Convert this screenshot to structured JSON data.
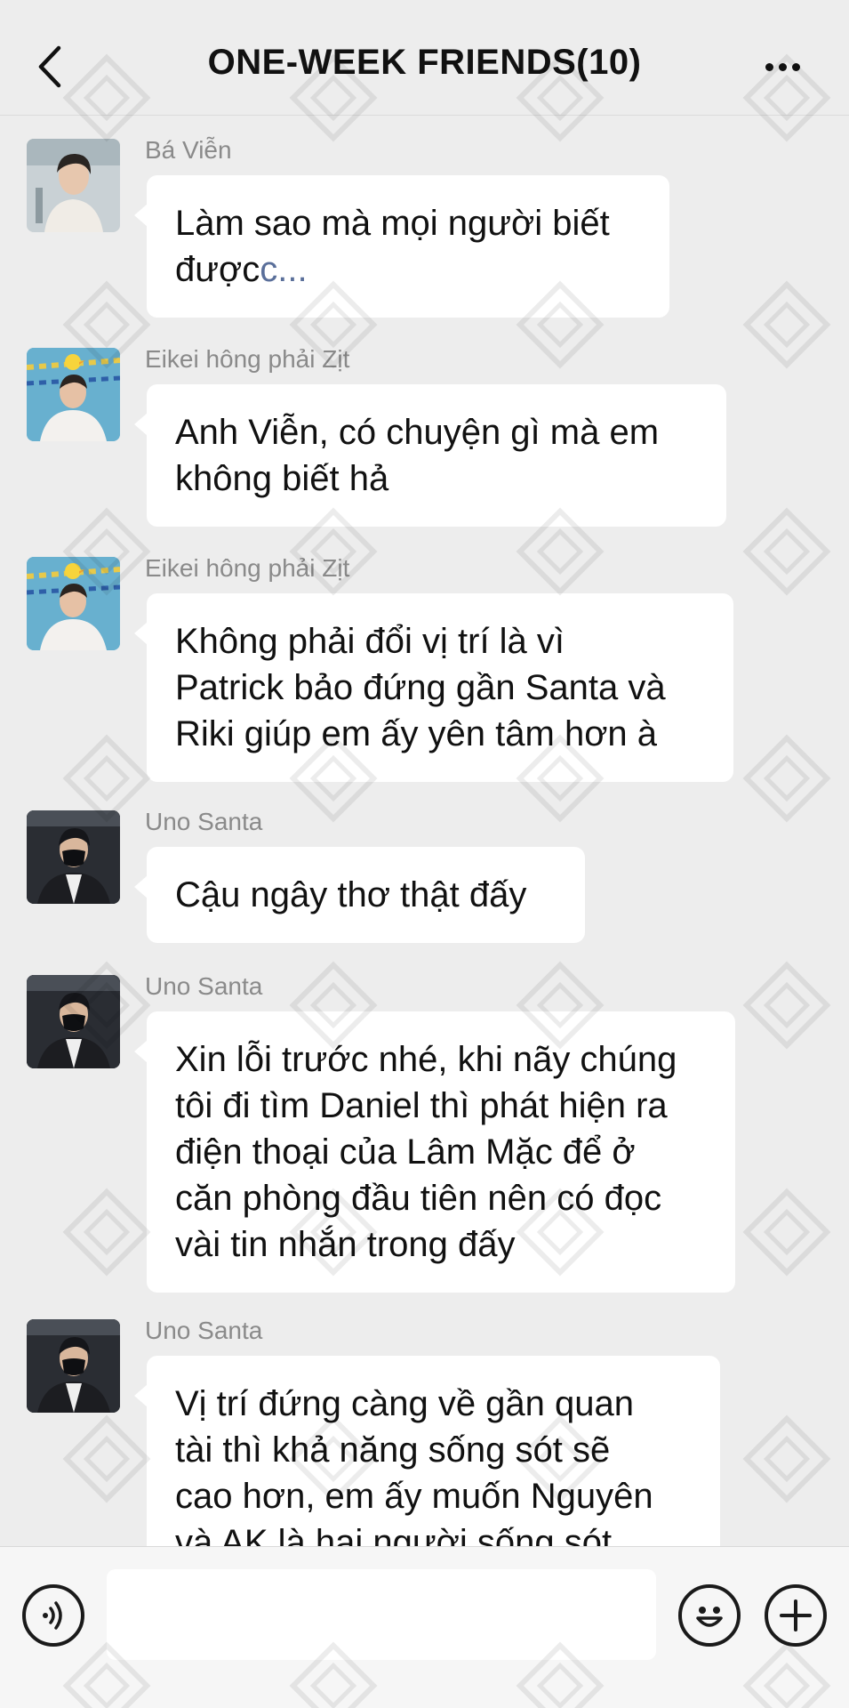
{
  "header": {
    "title": "ONE-WEEK FRIENDS(10)",
    "back_icon": "chevron-left-icon",
    "more_icon": "more-dots-icon"
  },
  "messages": [
    {
      "sender": "Bá Viễn",
      "avatar": "avatar-ba-vien",
      "lines": [
        "Làm sao mà mọi người biết",
        "được",
        "c..."
      ]
    },
    {
      "sender": "Eikei hông phải Zịt",
      "avatar": "avatar-eikei",
      "lines": [
        "Anh Viễn, có chuyện gì mà em",
        "không biết hả"
      ]
    },
    {
      "sender": "Eikei hông phải Zịt",
      "avatar": "avatar-eikei",
      "lines": [
        "Không phải đổi vị trí là vì",
        "Patrick bảo đứng gần Santa và",
        "Riki giúp em ấy yên tâm hơn à"
      ]
    },
    {
      "sender": "Uno Santa",
      "avatar": "avatar-uno-santa",
      "lines": [
        "Cậu ngây thơ thật đấy"
      ]
    },
    {
      "sender": "Uno Santa",
      "avatar": "avatar-uno-santa",
      "lines": [
        "Xin lỗi trước nhé, khi nãy chúng",
        "tôi đi tìm Daniel thì phát hiện ra",
        "điện thoại của Lâm Mặc để ở",
        "căn phòng đầu tiên nên có đọc",
        "vài tin nhắn trong đấy"
      ]
    },
    {
      "sender": "Uno Santa",
      "avatar": "avatar-uno-santa",
      "lines": [
        "Vị trí đứng càng về gần quan",
        "tài thì khả năng sống sót sẽ",
        "cao hơn, em ấy muốn Nguyên",
        "và AK là hai người sống sót"
      ]
    }
  ],
  "input_bar": {
    "placeholder": "",
    "voice_icon": "voice-icon",
    "emoji_icon": "emoji-icon",
    "plus_icon": "plus-icon"
  },
  "colors": {
    "background": "#ededed",
    "bubble": "#ffffff",
    "sender_text": "#8a8a8a",
    "faded_text": "#5a6f9a"
  }
}
